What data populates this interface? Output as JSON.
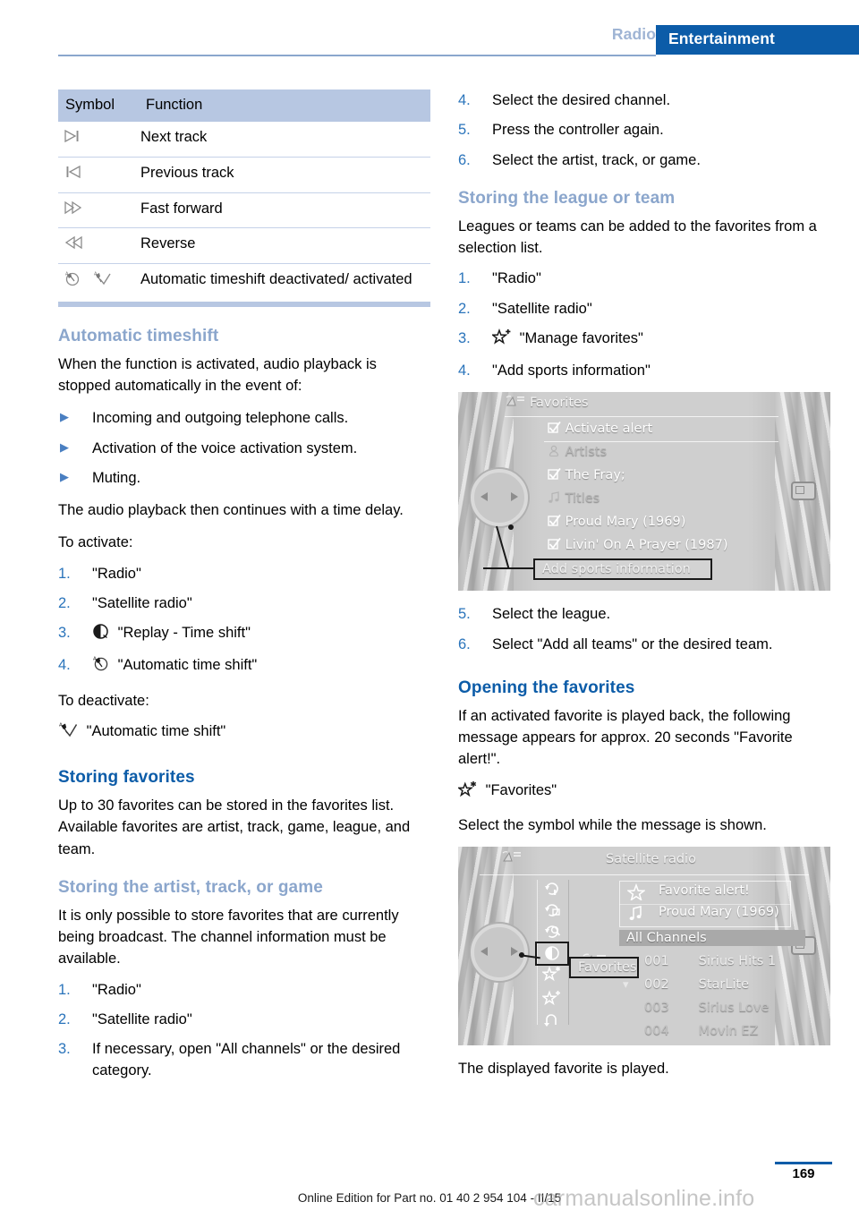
{
  "header": {
    "tab_inactive": "Radio",
    "tab_active": "Entertainment",
    "accent_blue": "#0c5ca8",
    "muted_blue": "#9fb4d4"
  },
  "symbol_table": {
    "headers": {
      "symbol": "Symbol",
      "function": "Function"
    },
    "rows": [
      {
        "symbol": "next-track-icon",
        "function": "Next track"
      },
      {
        "symbol": "previous-track-icon",
        "function": "Previous track"
      },
      {
        "symbol": "fast-forward-icon",
        "function": "Fast forward"
      },
      {
        "symbol": "reverse-icon",
        "function": "Reverse"
      },
      {
        "symbol": "auto-timeshift-icons",
        "function": "Automatic timeshift deactivated/ activated"
      }
    ]
  },
  "left_column": {
    "automatic_timeshift": {
      "heading": "Automatic timeshift",
      "intro": "When the function is activated, audio playback is stopped automatically in the event of:",
      "bullets": [
        "Incoming and outgoing telephone calls.",
        "Activation of the voice activation system.",
        "Muting."
      ],
      "after": "The audio playback then continues with a time delay.",
      "activate_label": "To activate:",
      "activate_steps": [
        {
          "num": "1.",
          "text": "\"Radio\""
        },
        {
          "num": "2.",
          "text": "\"Satellite radio\""
        },
        {
          "num": "3.",
          "text": "\"Replay - Time shift\"",
          "icon": "replay-timeshift-icon"
        },
        {
          "num": "4.",
          "text": "\"Automatic time shift\"",
          "icon": "auto-timeshift-off-icon"
        }
      ],
      "deactivate_label": "To deactivate:",
      "deactivate_line": "\"Automatic time shift\"",
      "deactivate_icon": "auto-timeshift-on-icon"
    },
    "storing_favorites": {
      "heading": "Storing favorites",
      "body": "Up to 30 favorites can be stored in the favorites list. Available favorites are artist, track, game, league, and team."
    },
    "storing_artist": {
      "heading": "Storing the artist, track, or game",
      "body": "It is only possible to store favorites that are currently being broadcast. The channel information must be available.",
      "steps": [
        {
          "num": "1.",
          "text": "\"Radio\""
        },
        {
          "num": "2.",
          "text": "\"Satellite radio\""
        },
        {
          "num": "3.",
          "text": "If necessary, open \"All channels\" or the desired category."
        }
      ]
    }
  },
  "right_column": {
    "continued_steps": [
      {
        "num": "4.",
        "text": "Select the desired channel."
      },
      {
        "num": "5.",
        "text": "Press the controller again."
      },
      {
        "num": "6.",
        "text": "Select the artist, track, or game."
      }
    ],
    "storing_league": {
      "heading": "Storing the league or team",
      "body": "Leagues or teams can be added to the favorites from a selection list.",
      "steps": [
        {
          "num": "1.",
          "text": "\"Radio\""
        },
        {
          "num": "2.",
          "text": "\"Satellite radio\""
        },
        {
          "num": "3.",
          "text": "\"Manage favorites\"",
          "icon": "star-plus-icon"
        },
        {
          "num": "4.",
          "text": "\"Add sports information\""
        }
      ],
      "steps_after": [
        {
          "num": "5.",
          "text": "Select the league."
        },
        {
          "num": "6.",
          "text": "Select \"Add all teams\" or the desired team."
        }
      ]
    },
    "opening_favorites": {
      "heading": "Opening the favorites",
      "body": "If an activated favorite is played back, the following message appears for approx. 20 seconds \"Favorite alert!\".",
      "favorites_line": "\"Favorites\"",
      "favorites_icon": "star-asterisk-icon",
      "after": "Select the symbol while the message is shown.",
      "closing": "The displayed favorite is played."
    }
  },
  "screenshot_favorites": {
    "title": "Favorites",
    "title_icon": "satellite-radio-icon",
    "items": [
      {
        "label": "Activate alert",
        "icon": "checkbox-checked-icon",
        "dim": false
      },
      {
        "label": "Artists",
        "icon": "artist-icon",
        "dim": true
      },
      {
        "label": "The Fray;",
        "icon": "checkbox-checked-icon",
        "dim": false
      },
      {
        "label": "Titles",
        "icon": "music-note-icon",
        "dim": true
      },
      {
        "label": "Proud Mary (1969)",
        "icon": "checkbox-checked-icon",
        "dim": false
      },
      {
        "label": "Livin' On A Prayer (1987)",
        "icon": "checkbox-checked-icon",
        "dim": false
      }
    ],
    "callout": "Add sports information"
  },
  "screenshot_satellite": {
    "title": "Satellite radio",
    "title_icon": "satellite-radio-icon",
    "rail_icons": [
      "repeat-icon",
      "category-icon",
      "search-icon",
      "replay-timeshift-icon",
      "star-asterisk-icon",
      "star-plus-icon",
      "back-icon"
    ],
    "selected_rail_index": 4,
    "callout": "Favorites",
    "info_rows": [
      {
        "icon": "star-icon",
        "label": "Favorite alert!"
      },
      {
        "icon": "music-note-icon",
        "label": "Proud Mary (1969)"
      }
    ],
    "channel_bar": "All Channels",
    "channels": [
      {
        "num": "001",
        "name": "Sirius Hits 1",
        "dim": false
      },
      {
        "num": "002",
        "name": "StarLite",
        "dim": false
      },
      {
        "num": "003",
        "name": "Sirius Love",
        "dim": true
      },
      {
        "num": "004",
        "name": "Movin EZ",
        "dim": true
      }
    ]
  },
  "footer": {
    "page_number": "169",
    "credit": "Online Edition for Part no. 01 40 2 954 104 - II/15",
    "watermark": "carmanualsonline.info"
  }
}
